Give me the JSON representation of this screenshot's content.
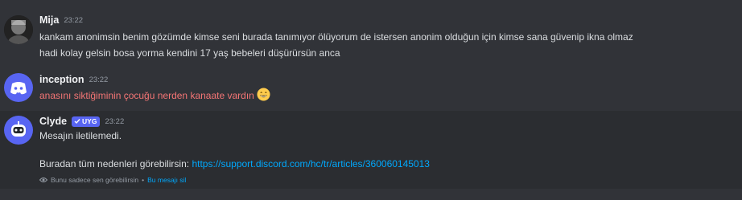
{
  "messages": [
    {
      "username": "Mija",
      "time": "23:22",
      "lines": [
        "kankam anonimsin benim gözümde kimse seni burada tanımıyor ölüyorum de istersen anonim olduğun için kimse sana güvenip ikna olmaz",
        "hadi kolay gelsin bosa yorma kendini 17 yaş bebeleri düşürürsün anca"
      ]
    },
    {
      "username": "inception",
      "time": "23:22",
      "text": "anasını siktiğiminin çocuğu nerden kanaate vardın",
      "emoji": "grinning-face-emoji"
    },
    {
      "username": "Clyde",
      "badge": "UYG",
      "time": "23:22",
      "line1": "Mesajın iletilemedi.",
      "line2_prefix": "Buradan tüm nedenleri görebilirsin:",
      "link": "https://support.discord.com/hc/tr/articles/360060145013",
      "ephemeral_text": "Bunu sadece sen görebilirsin",
      "ephemeral_sep": "•",
      "dismiss_label": "Bu mesajı sil"
    }
  ],
  "colors": {
    "background": "#313338",
    "clyde_background": "#2b2d31",
    "discord_blurple": "#5865f2",
    "link": "#00a8fc",
    "mention_red": "#f47575"
  }
}
